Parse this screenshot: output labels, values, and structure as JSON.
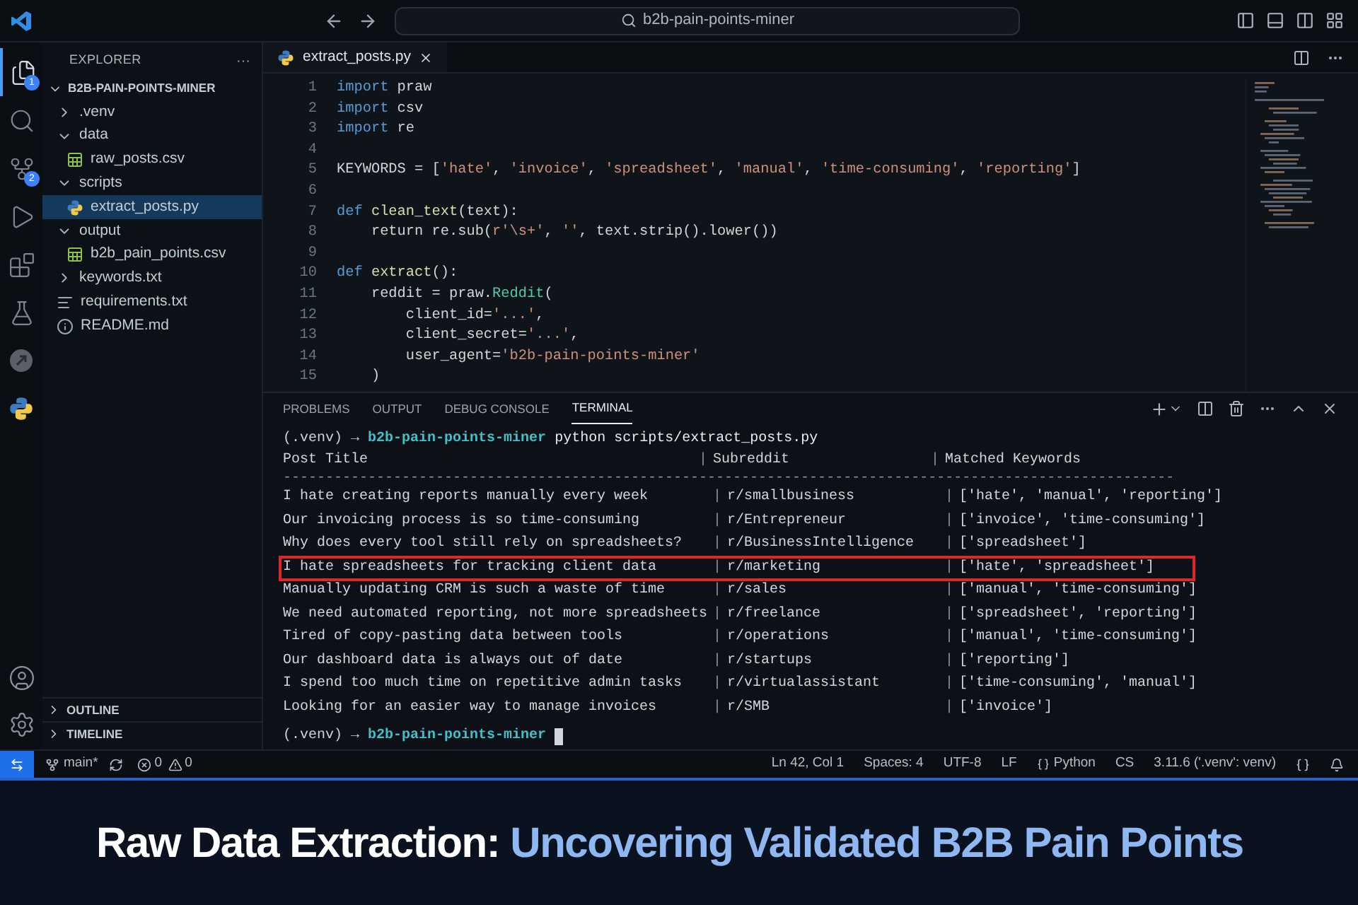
{
  "title_bar": {
    "search": "b2b-pain-points-miner"
  },
  "activity_bar": [
    {
      "kind": "files",
      "badge": "1",
      "selected": true
    },
    {
      "kind": "search",
      "selected": false
    },
    {
      "kind": "git",
      "badge": "2",
      "selected": false
    },
    {
      "kind": "debug",
      "selected": false
    },
    {
      "kind": "extensions",
      "selected": false
    },
    {
      "kind": "flask",
      "selected": false
    },
    {
      "kind": "remote",
      "selected": false
    },
    {
      "kind": "python",
      "selected": false
    }
  ],
  "sidebar": {
    "title": "EXPLORER",
    "more": "···",
    "root": "B2B-PAIN-POINTS-MINER",
    "items": [
      {
        "label": ".venv",
        "kind": "folder",
        "expanded": false,
        "selected": false
      },
      {
        "label": "data",
        "kind": "folder",
        "expanded": true,
        "selected": false,
        "children": [
          {
            "label": "raw_posts.csv",
            "kind": "csv",
            "selected": false
          }
        ]
      },
      {
        "label": "scripts",
        "kind": "folder",
        "expanded": true,
        "selected": false,
        "children": [
          {
            "label": "extract_posts.py",
            "kind": "python",
            "selected": true
          }
        ]
      },
      {
        "label": "output",
        "kind": "folder",
        "expanded": true,
        "selected": false,
        "children": [
          {
            "label": "b2b_pain_points.csv",
            "kind": "csv",
            "selected": false
          }
        ]
      },
      {
        "label": "keywords.txt",
        "kind": "folder",
        "expanded": false,
        "selected": false
      },
      {
        "label": "requirements.txt",
        "kind": "text",
        "selected": false
      },
      {
        "label": "README.md",
        "kind": "info",
        "selected": false
      }
    ],
    "sections": [
      "OUTLINE",
      "TIMELINE"
    ]
  },
  "editor": {
    "tab": "extract_posts.py",
    "lines": [
      {
        "number": "1",
        "tokens": [
          {
            "text": "import",
            "kind": "keyword"
          },
          {
            "text": " praw",
            "kind": "plain"
          }
        ]
      },
      {
        "number": "2",
        "tokens": [
          {
            "text": "import",
            "kind": "keyword"
          },
          {
            "text": " csv",
            "kind": "plain"
          }
        ]
      },
      {
        "number": "3",
        "tokens": [
          {
            "text": "import",
            "kind": "keyword"
          },
          {
            "text": " re",
            "kind": "plain"
          }
        ]
      },
      {
        "number": "4"
      },
      {
        "number": "5",
        "tokens": [
          {
            "text": "KEYWORDS = [",
            "kind": "plain"
          },
          {
            "text": "'hate'",
            "kind": "string"
          },
          {
            "text": ", ",
            "kind": "plain"
          },
          {
            "text": "'invoice'",
            "kind": "string"
          },
          {
            "text": ", ",
            "kind": "plain"
          },
          {
            "text": "'spreadsheet'",
            "kind": "string"
          },
          {
            "text": ", ",
            "kind": "plain"
          },
          {
            "text": "'manual'",
            "kind": "string"
          },
          {
            "text": ", ",
            "kind": "plain"
          },
          {
            "text": "'time-consuming'",
            "kind": "string"
          },
          {
            "text": ", ",
            "kind": "plain"
          },
          {
            "text": "'reporting'",
            "kind": "string"
          },
          {
            "text": "]",
            "kind": "plain"
          }
        ]
      },
      {
        "number": "6"
      },
      {
        "number": "7",
        "tokens": [
          {
            "text": "def",
            "kind": "keyword"
          },
          {
            "text": " clean_text",
            "kind": "function"
          },
          {
            "text": "(text):",
            "kind": "plain"
          }
        ]
      },
      {
        "number": "8",
        "tokens": [
          {
            "text": "    return re.sub(",
            "kind": "plain"
          },
          {
            "text": "r'\\s+'",
            "kind": "string"
          },
          {
            "text": ", ",
            "kind": "plain"
          },
          {
            "text": "''",
            "kind": "string"
          },
          {
            "text": ", text.strip().lower())",
            "kind": "plain"
          }
        ]
      },
      {
        "number": "9"
      },
      {
        "number": "10",
        "tokens": [
          {
            "text": "def",
            "kind": "keyword"
          },
          {
            "text": " extract",
            "kind": "function"
          },
          {
            "text": "():",
            "kind": "plain"
          }
        ]
      },
      {
        "number": "11",
        "tokens": [
          {
            "text": "    reddit = praw.",
            "kind": "plain"
          },
          {
            "text": "Reddit",
            "kind": "class"
          },
          {
            "text": "(",
            "kind": "plain"
          }
        ]
      },
      {
        "number": "12",
        "tokens": [
          {
            "text": "        client_id=",
            "kind": "plain"
          },
          {
            "text": "'...'",
            "kind": "string"
          },
          {
            "text": ",",
            "kind": "plain"
          }
        ]
      },
      {
        "number": "13",
        "tokens": [
          {
            "text": "        client_secret=",
            "kind": "plain"
          },
          {
            "text": "'...'",
            "kind": "string"
          },
          {
            "text": ",",
            "kind": "plain"
          }
        ]
      },
      {
        "number": "14",
        "tokens": [
          {
            "text": "        user_agent=",
            "kind": "plain"
          },
          {
            "text": "'b2b-pain-points-miner'",
            "kind": "string"
          }
        ]
      },
      {
        "number": "15",
        "tokens": [
          {
            "text": "    )",
            "kind": "plain"
          }
        ]
      }
    ]
  },
  "panel": {
    "tabs": [
      {
        "label": "PROBLEMS",
        "selected": false
      },
      {
        "label": "OUTPUT",
        "selected": false
      },
      {
        "label": "DEBUG CONSOLE",
        "selected": false
      },
      {
        "label": "TERMINAL",
        "selected": true
      }
    ],
    "terminal": {
      "prompts": [
        {
          "env": "(.venv)",
          "arrow": "→",
          "project": "b2b-pain-points-miner",
          "command": "python scripts/extract_posts.py"
        },
        {
          "env": "(.venv)",
          "arrow": "→",
          "project": "b2b-pain-points-miner",
          "cursor": true
        }
      ],
      "separator": "|",
      "columns": [
        "Post Title",
        "Subreddit",
        "Matched Keywords"
      ],
      "rule": "---------------------------------------------------------------------------------------------------------",
      "rows": [
        {
          "title": "I hate creating reports manually every week",
          "subreddit": "r/smallbusiness",
          "keywords": "['hate', 'manual', 'reporting']",
          "highlighted": false
        },
        {
          "title": "Our invoicing process is so time-consuming",
          "subreddit": "r/Entrepreneur",
          "keywords": "['invoice', 'time-consuming']",
          "highlighted": false
        },
        {
          "title": "Why does every tool still rely on spreadsheets?",
          "subreddit": "r/BusinessIntelligence",
          "keywords": "['spreadsheet']",
          "highlighted": false
        },
        {
          "title": "I hate spreadsheets for tracking client data",
          "subreddit": "r/marketing",
          "keywords": "['hate', 'spreadsheet']",
          "highlighted": true
        },
        {
          "title": "Manually updating CRM is such a waste of time",
          "subreddit": "r/sales",
          "keywords": "['manual', 'time-consuming']",
          "highlighted": false
        },
        {
          "title": "We need automated reporting, not more spreadsheets",
          "subreddit": "r/freelance",
          "keywords": "['spreadsheet', 'reporting']",
          "highlighted": false
        },
        {
          "title": "Tired of copy-pasting data between tools",
          "subreddit": "r/operations",
          "keywords": "['manual', 'time-consuming']",
          "highlighted": false
        },
        {
          "title": "Our dashboard data is always out of date",
          "subreddit": "r/startups",
          "keywords": "['reporting']",
          "highlighted": false
        },
        {
          "title": "I spend too much time on repetitive admin tasks",
          "subreddit": "r/virtualassistant",
          "keywords": "['time-consuming', 'manual']",
          "highlighted": false
        },
        {
          "title": "Looking for an easier way to manage invoices",
          "subreddit": "r/SMB",
          "keywords": "['invoice']",
          "highlighted": false
        }
      ]
    }
  },
  "status_bar": {
    "branch": "main*",
    "errors": "0",
    "warnings": "0",
    "right": [
      {
        "text": "Ln 42, Col 1",
        "kind": "text"
      },
      {
        "text": "Spaces: 4",
        "kind": "text"
      },
      {
        "text": "UTF-8",
        "kind": "text"
      },
      {
        "text": "LF",
        "kind": "text"
      },
      {
        "text": "Python",
        "kind": "language"
      },
      {
        "text": "CS",
        "kind": "text"
      },
      {
        "text": "3.11.6 ('.venv': venv)",
        "kind": "text"
      }
    ]
  },
  "caption": {
    "lead": "Raw Data Extraction:",
    "rest": "Uncovering Validated B2B Pain Points"
  }
}
